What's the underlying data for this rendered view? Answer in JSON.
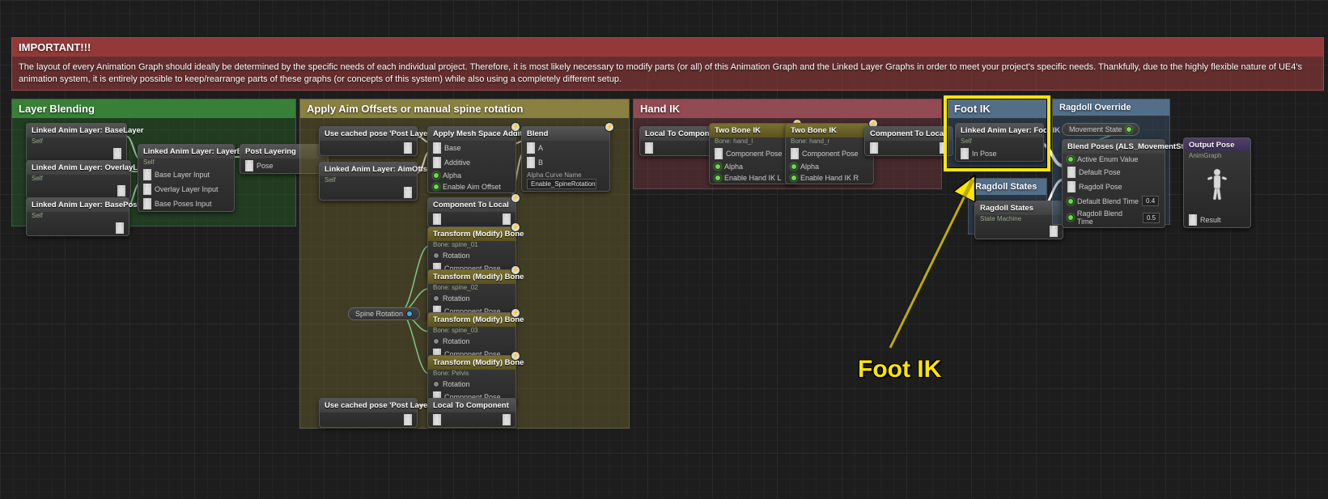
{
  "important": {
    "title": "IMPORTANT!!!",
    "body": "The layout of every Animation Graph should ideally be determined by the specific needs of each individual project. Therefore, it is most likely necessary to modify parts (or all) of this Animation Graph and the Linked Layer Graphs in order to meet your project's specific needs. Thankfully, due to the highly flexible nature of UE4's animation system, it is entirely possible to keep/rearrange parts of these graphs (or concepts of this system) while also using a completely different setup."
  },
  "sections": {
    "layer_blending": {
      "title": "Layer Blending"
    },
    "aim_offsets": {
      "title": "Apply Aim Offsets or manual spine rotation"
    },
    "hand_ik": {
      "title": "Hand IK"
    },
    "foot_ik": {
      "title": "Foot IK"
    },
    "ragdoll_override": {
      "title": "Ragdoll Override"
    },
    "ragdoll_states": {
      "title": "Ragdoll States"
    }
  },
  "nodes": {
    "lal_base": {
      "title": "Linked Anim Layer: BaseLayer",
      "sub": "Self"
    },
    "lal_overlay": {
      "title": "Linked Anim Layer: OverlayLayer",
      "sub": "Self"
    },
    "lal_poses": {
      "title": "Linked Anim Layer: BasePoses",
      "sub": "Self"
    },
    "lal_blend": {
      "title": "Linked Anim Layer: LayerBlending",
      "sub": "Self",
      "in1": "Base Layer Input",
      "in2": "Overlay Layer Input",
      "in3": "Base Poses Input"
    },
    "post_layering": {
      "title": "Post Layering",
      "row": "Pose"
    },
    "cache_post1": {
      "title": "Use cached pose 'Post Layering'"
    },
    "cache_post2": {
      "title": "Use cached pose 'Post Layering'"
    },
    "lal_aim": {
      "title": "Linked Anim Layer: AimOffsetBehaviors",
      "sub": "Self"
    },
    "apply_add": {
      "title": "Apply Mesh Space Additive",
      "row_base": "Base",
      "row_add": "Additive",
      "row_alpha": "Alpha",
      "row_enable": "Enable Aim Offset"
    },
    "blend": {
      "title": "Blend",
      "row_a": "A",
      "row_b": "B",
      "row_curve_label": "Alpha Curve Name",
      "row_curve_value": "Enable_SpineRotation"
    },
    "comp_to_local1": {
      "title": "Component To Local"
    },
    "local_to_comp": {
      "title": "Local To Component"
    },
    "tmb1": {
      "title": "Transform (Modify) Bone",
      "sub": "Bone: spine_01",
      "r1": "Rotation",
      "r2": "Component Pose"
    },
    "tmb2": {
      "title": "Transform (Modify) Bone",
      "sub": "Bone: spine_02",
      "r1": "Rotation",
      "r2": "Component Pose"
    },
    "tmb3": {
      "title": "Transform (Modify) Bone",
      "sub": "Bone: spine_03",
      "r1": "Rotation",
      "r2": "Component Pose"
    },
    "tmb4": {
      "title": "Transform (Modify) Bone",
      "sub": "Bone: Pelvis",
      "r1": "Rotation",
      "r2": "Component Pose"
    },
    "spine_rot": {
      "label": "Spine Rotation"
    },
    "h_local_to_comp": {
      "title": "Local To Component"
    },
    "h_twobone1": {
      "title": "Two Bone IK",
      "sub": "Bone: hand_l",
      "r1": "Component Pose",
      "r2": "Alpha",
      "r3": "Enable Hand IK L"
    },
    "h_twobone2": {
      "title": "Two Bone IK",
      "sub": "Bone: hand_r",
      "r1": "Component Pose",
      "r2": "Alpha",
      "r3": "Enable Hand IK R"
    },
    "h_comp_to_local": {
      "title": "Component To Local"
    },
    "lal_footik": {
      "title": "Linked Anim Layer: Foot IK",
      "sub": "Self",
      "row": "In Pose"
    },
    "ragdoll_states_node": {
      "title": "Ragdoll States",
      "sub": "State Machine"
    },
    "movement_state": {
      "title": "Movement State"
    },
    "blend_poses": {
      "title": "Blend Poses (ALS_MovementState)",
      "r1": "Active Enum Value",
      "r2": "Default Pose",
      "r3": "Ragdoll Pose",
      "r4": "Default Blend Time",
      "v4": "0.4",
      "r5": "Ragdoll Blend Time",
      "v5": "0.5"
    },
    "output_pose": {
      "title": "Output Pose",
      "sub": "AnimGraph",
      "row": "Result"
    }
  },
  "annotation": {
    "label": "Foot IK"
  }
}
